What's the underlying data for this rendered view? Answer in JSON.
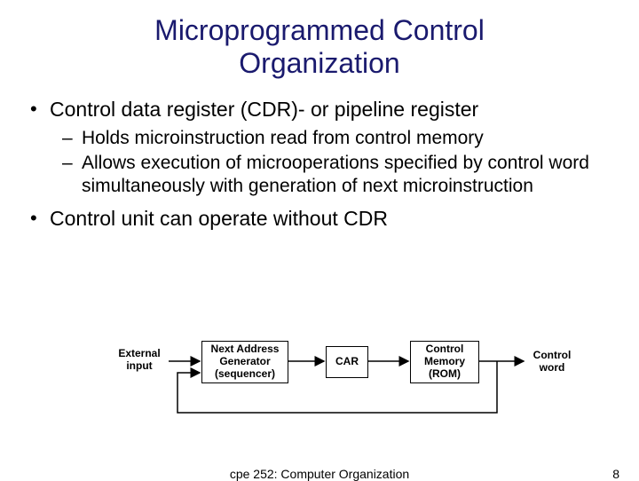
{
  "title_line1": "Microprogrammed Control",
  "title_line2": "Organization",
  "bullets": {
    "b1": "Control data register (CDR)- or pipeline register",
    "b1_sub1": "Holds microinstruction read from control memory",
    "b1_sub2": "Allows execution of microoperations specified by control word simultaneously with generation of next microinstruction",
    "b2": "Control unit can operate without CDR"
  },
  "diagram": {
    "external_input": "External\ninput",
    "next_addr": "Next Address\nGenerator\n(sequencer)",
    "car": "CAR",
    "control_memory": "Control\nMemory\n(ROM)",
    "control_word": "Control\nword"
  },
  "footer": {
    "course": "cpe 252: Computer Organization",
    "page": "8"
  },
  "chart_data": {
    "type": "diagram",
    "nodes": [
      {
        "id": "external_input",
        "label": "External input",
        "kind": "label"
      },
      {
        "id": "next_addr_gen",
        "label": "Next Address Generator (sequencer)",
        "kind": "box"
      },
      {
        "id": "car",
        "label": "CAR",
        "kind": "box"
      },
      {
        "id": "control_memory",
        "label": "Control Memory (ROM)",
        "kind": "box"
      },
      {
        "id": "control_word",
        "label": "Control word",
        "kind": "label"
      }
    ],
    "edges": [
      {
        "from": "external_input",
        "to": "next_addr_gen"
      },
      {
        "from": "next_addr_gen",
        "to": "car"
      },
      {
        "from": "car",
        "to": "control_memory"
      },
      {
        "from": "control_memory",
        "to": "control_word"
      },
      {
        "from": "control_memory",
        "to": "next_addr_gen",
        "note": "feedback loop"
      }
    ]
  }
}
